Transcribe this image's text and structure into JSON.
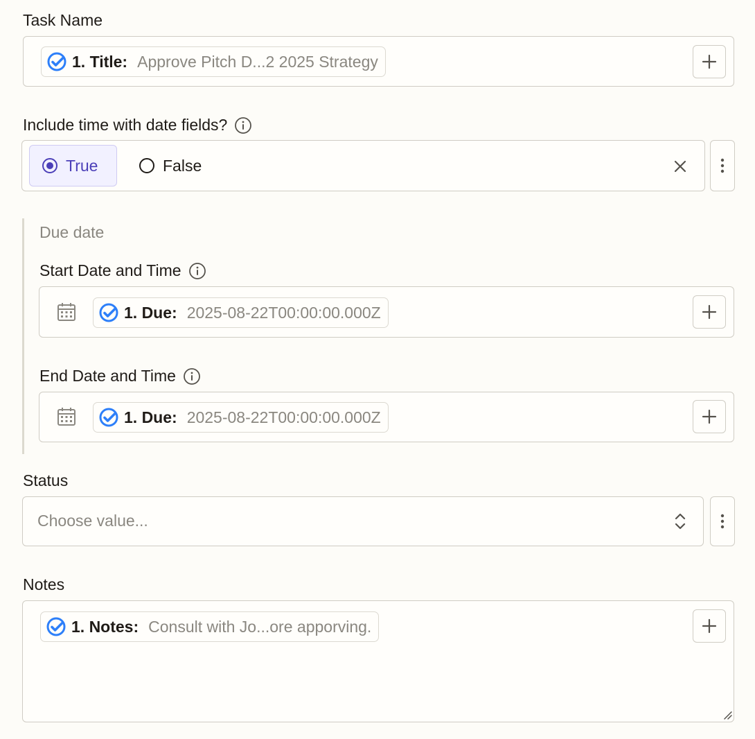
{
  "task_name": {
    "label": "Task Name",
    "pill": {
      "key": "1. Title:",
      "value": "Approve Pitch D...2 2025 Strategy"
    }
  },
  "include_time": {
    "label": "Include time with date fields?",
    "options": [
      {
        "label": "True",
        "selected": true
      },
      {
        "label": "False",
        "selected": false
      }
    ]
  },
  "due_date": {
    "title": "Due date",
    "start": {
      "label": "Start Date and Time",
      "pill": {
        "key": "1. Due:",
        "value": "2025-08-22T00:00:00.000Z"
      }
    },
    "end": {
      "label": "End Date and Time",
      "pill": {
        "key": "1. Due:",
        "value": "2025-08-22T00:00:00.000Z"
      }
    }
  },
  "status": {
    "label": "Status",
    "placeholder": "Choose value..."
  },
  "notes": {
    "label": "Notes",
    "pill": {
      "key": "1. Notes:",
      "value": "Consult with Jo...ore apporving."
    }
  },
  "colors": {
    "accent": "#4b3fb8",
    "app_icon_blue": "#2d7ff9",
    "border": "#cfccc4",
    "background": "#fdfcf8"
  },
  "icons": {
    "app": "circle-check-icon",
    "info": "info-icon",
    "add": "plus-icon",
    "calendar": "calendar-icon",
    "more": "kebab-icon",
    "clear": "close-icon",
    "select": "chevron-up-down-icon"
  }
}
